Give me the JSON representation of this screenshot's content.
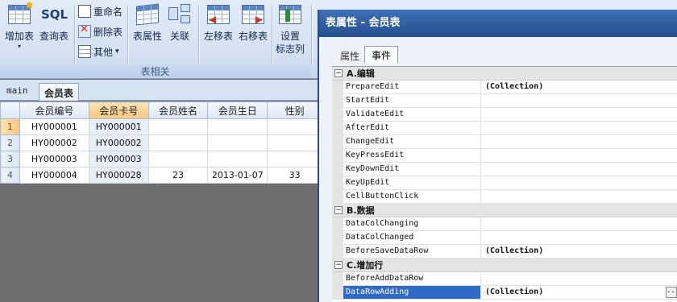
{
  "ribbon": {
    "add_table": "增加表",
    "query_table": "查询表",
    "sql_text": "SQL",
    "rename": "重命名",
    "delete_table": "删除表",
    "other": "其他",
    "table_props": "表属性",
    "relate": "关联",
    "move_left": "左移表",
    "move_right": "右移表",
    "setup_line1": "设置",
    "setup_line2": "标志列",
    "group_label": "表相关"
  },
  "sheet_tabs": [
    "main",
    "会员表"
  ],
  "grid": {
    "columns": [
      "会员编号",
      "会员卡号",
      "会员姓名",
      "会员生日",
      "性别"
    ],
    "rows": [
      {
        "n": "1",
        "cells": [
          "HY000001",
          "HY000001",
          "",
          "",
          ""
        ]
      },
      {
        "n": "2",
        "cells": [
          "HY000002",
          "HY000002",
          "",
          "",
          ""
        ]
      },
      {
        "n": "3",
        "cells": [
          "HY000003",
          "HY000003",
          "",
          "",
          ""
        ]
      },
      {
        "n": "4",
        "cells": [
          "HY000004",
          "HY000028",
          "23",
          "2013-01-07",
          "33"
        ]
      }
    ]
  },
  "dialog": {
    "title": "表属性 - 会员表",
    "tabs": [
      "属性",
      "事件"
    ],
    "categories": [
      {
        "label": "A.编辑",
        "toggle": "−",
        "rows": [
          {
            "name": "PrepareEdit",
            "value": "(Collection)"
          },
          {
            "name": "StartEdit",
            "value": ""
          },
          {
            "name": "ValidateEdit",
            "value": ""
          },
          {
            "name": "AfterEdit",
            "value": ""
          },
          {
            "name": "ChangeEdit",
            "value": ""
          },
          {
            "name": "KeyPressEdit",
            "value": ""
          },
          {
            "name": "KeyDownEdit",
            "value": ""
          },
          {
            "name": "KeyUpEdit",
            "value": ""
          },
          {
            "name": "CellButtonClick",
            "value": ""
          }
        ]
      },
      {
        "label": "B.数据",
        "toggle": "−",
        "rows": [
          {
            "name": "DataColChanging",
            "value": ""
          },
          {
            "name": "DataColChanged",
            "value": ""
          },
          {
            "name": "BeforeSaveDataRow",
            "value": "(Collection)"
          }
        ]
      },
      {
        "label": "C.增加行",
        "toggle": "−",
        "rows": [
          {
            "name": "BeforeAddDataRow",
            "value": ""
          },
          {
            "name": "DataRowAdding",
            "value": "(Collection)",
            "selected": true,
            "ellipsis": "..."
          }
        ]
      }
    ]
  }
}
